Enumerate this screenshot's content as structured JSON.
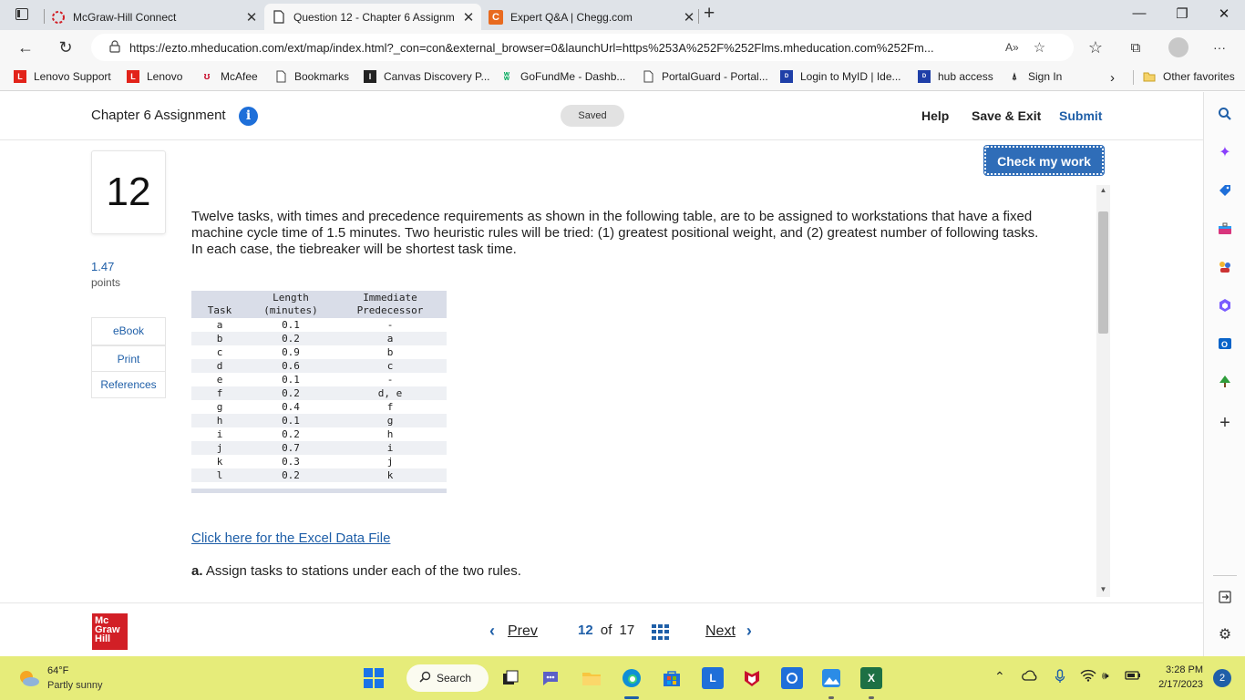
{
  "browser": {
    "tabs": [
      {
        "title": "McGraw-Hill Connect"
      },
      {
        "title": "Question 12 - Chapter 6 Assignm"
      },
      {
        "title": "Expert Q&A | Chegg.com"
      }
    ],
    "url": "https://ezto.mheducation.com/ext/map/index.html?_con=con&external_browser=0&launchUrl=https%253A%252F%252Flms.mheducation.com%252Fm...",
    "favorites": [
      {
        "label": "Lenovo Support"
      },
      {
        "label": "Lenovo"
      },
      {
        "label": "McAfee"
      },
      {
        "label": "Bookmarks"
      },
      {
        "label": "Canvas Discovery P..."
      },
      {
        "label": "GoFundMe - Dashb..."
      },
      {
        "label": "PortalGuard - Portal..."
      },
      {
        "label": "Login to MyID | Ide..."
      },
      {
        "label": "hub access"
      },
      {
        "label": "Sign In"
      }
    ],
    "other_favorites": "Other favorites"
  },
  "header": {
    "title": "Chapter 6 Assignment",
    "info_icon": "i",
    "saved": "Saved",
    "help": "Help",
    "save_exit": "Save & Exit",
    "submit": "Submit"
  },
  "question": {
    "number": "12",
    "points_value": "1.47",
    "points_label": "points",
    "side_buttons": [
      "eBook",
      "Print",
      "References"
    ],
    "check_button": "Check my work",
    "text": "Twelve tasks, with times and precedence requirements as shown in the following table, are to be assigned to workstations that have a fixed machine cycle time of 1.5 minutes. Two heuristic rules will be tried: (1) greatest positional weight, and (2) greatest number of following tasks.",
    "text2": "In each case, the tiebreaker will be shortest task time.",
    "excel_link": "Click here for the Excel Data File",
    "part_a_label": "a.",
    "part_a_text": "Assign tasks to stations under each of the two rules."
  },
  "table": {
    "headers": {
      "task": "Task",
      "length_line1": "Length",
      "length_line2": "(minutes)",
      "pred_line1": "Immediate",
      "pred_line2": "Predecessor"
    },
    "rows": [
      {
        "task": "a",
        "length": "0.1",
        "pred": "-"
      },
      {
        "task": "b",
        "length": "0.2",
        "pred": "a"
      },
      {
        "task": "c",
        "length": "0.9",
        "pred": "b"
      },
      {
        "task": "d",
        "length": "0.6",
        "pred": "c"
      },
      {
        "task": "e",
        "length": "0.1",
        "pred": "-"
      },
      {
        "task": "f",
        "length": "0.2",
        "pred": "d, e"
      },
      {
        "task": "g",
        "length": "0.4",
        "pred": "f"
      },
      {
        "task": "h",
        "length": "0.1",
        "pred": "g"
      },
      {
        "task": "i",
        "length": "0.2",
        "pred": "h"
      },
      {
        "task": "j",
        "length": "0.7",
        "pred": "i"
      },
      {
        "task": "k",
        "length": "0.3",
        "pred": "j"
      },
      {
        "task": "l",
        "length": "0.2",
        "pred": "k"
      }
    ]
  },
  "footer": {
    "logo_lines": [
      "Mc",
      "Graw",
      "Hill"
    ],
    "prev": "Prev",
    "current_page": "12",
    "of_label": "of",
    "total_pages": "17",
    "next": "Next"
  },
  "taskbar": {
    "temperature": "64°F",
    "weather": "Partly sunny",
    "search": "Search",
    "time": "3:28 PM",
    "date": "2/17/2023",
    "notifications": "2"
  },
  "colors": {
    "accent_blue": "#1f5fa8",
    "check_button": "#2f6db8",
    "mh_red": "#d21f26",
    "taskbar": "#e6ec7a"
  }
}
